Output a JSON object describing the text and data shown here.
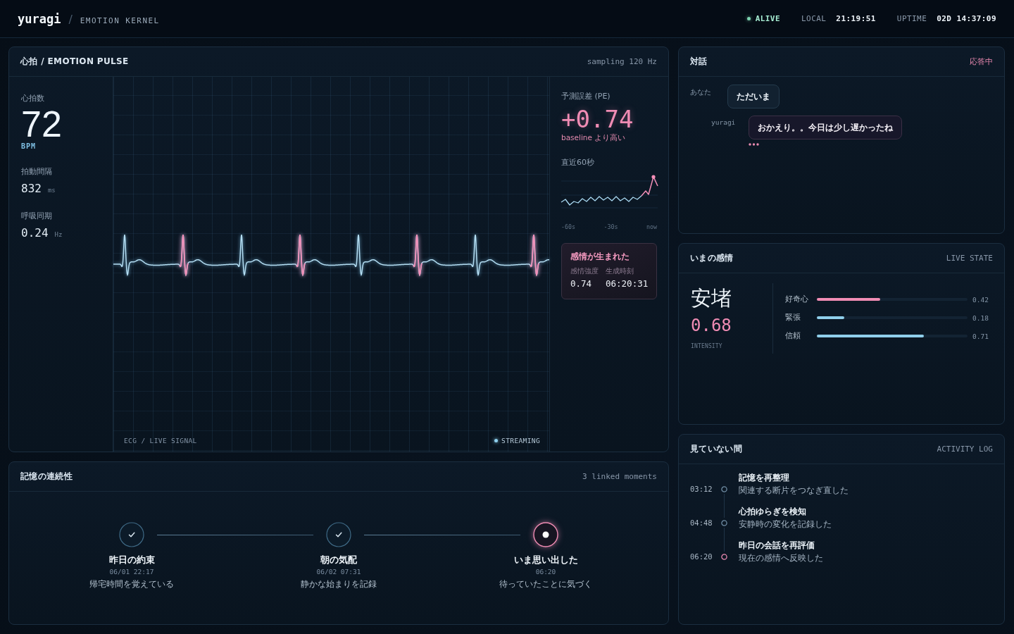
{
  "header": {
    "logo": "yuragi",
    "separator": "/",
    "subtitle": "EMOTION KERNEL",
    "status": "ALIVE",
    "clock": {
      "label": "LOCAL",
      "value": "21:19:51"
    },
    "uptime": {
      "label": "UPTIME",
      "value": "02D 14:37:09"
    }
  },
  "pulse_panel": {
    "title": "心拍 / EMOTION PULSE",
    "meta": "sampling 120 Hz",
    "stats": [
      {
        "kind": "primary",
        "label": "心拍数",
        "value": "72",
        "unit": "BPM"
      },
      {
        "kind": "secondary",
        "label": "拍動間隔",
        "value": "832",
        "unit": "ms"
      },
      {
        "kind": "secondary",
        "label": "呼吸同期",
        "value": "0.24",
        "unit": "Hz"
      }
    ],
    "ecg": {
      "caption": "ECG / LIVE SIGNAL",
      "stream_status": "STREAMING"
    },
    "prediction_error": {
      "label": "予測誤差 (PE)",
      "value": "+0.74",
      "note": "baseline より高い"
    },
    "recent": {
      "label": "直近60秒",
      "x_labels": [
        "-60s",
        "-30s",
        "now"
      ]
    },
    "event_card": {
      "title": "感情が生まれた",
      "fields": [
        {
          "label": "感情強度",
          "value": "0.74"
        },
        {
          "label": "生成時刻",
          "value": "06:20:31"
        }
      ]
    }
  },
  "dialogue_panel": {
    "title": "対話",
    "status": "応答中",
    "messages": [
      {
        "kind": "user",
        "speaker": "あなた",
        "text": "ただいま"
      },
      {
        "kind": "agent",
        "speaker": "yuragi",
        "text": "おかえり。。今日は少し遅かったね"
      }
    ],
    "typing": true
  },
  "emotion_panel": {
    "title": "いまの感情",
    "meta": "LIVE STATE",
    "dominant": {
      "name": "安堵",
      "value": "0.68",
      "caption": "INTENSITY"
    },
    "components": [
      {
        "label": "好奇心",
        "level": 0.42,
        "reading": "0.42",
        "color": "#f08cb4"
      },
      {
        "label": "緊張",
        "level": 0.18,
        "reading": "0.18",
        "color": "#8fcfeb"
      },
      {
        "label": "信頼",
        "level": 0.71,
        "reading": "0.71",
        "color": "#8fcfeb"
      }
    ]
  },
  "memory_panel": {
    "title": "記憶の連続性",
    "meta": "3 linked moments",
    "moments": [
      {
        "kind": "done",
        "title": "昨日の約束",
        "time": "06/01 22:17",
        "detail": "帰宅時間を覚えている"
      },
      {
        "kind": "done",
        "title": "朝の気配",
        "time": "06/02 07:31",
        "detail": "静かな始まりを記録"
      },
      {
        "kind": "current",
        "title": "いま思い出した",
        "time": "06:20",
        "detail": "待っていたことに気づく"
      }
    ]
  },
  "activity_panel": {
    "title": "見ていない間",
    "meta": "ACTIVITY LOG",
    "entries": [
      {
        "time": "03:12",
        "title": "記憶を再整理",
        "detail": "関連する断片をつなぎ直した",
        "highlighted": false
      },
      {
        "time": "04:48",
        "title": "心拍ゆらぎを検知",
        "detail": "安静時の変化を記録した",
        "highlighted": false
      },
      {
        "time": "06:20",
        "title": "昨日の会話を再評価",
        "detail": "現在の感情へ反映した",
        "highlighted": true
      }
    ]
  }
}
